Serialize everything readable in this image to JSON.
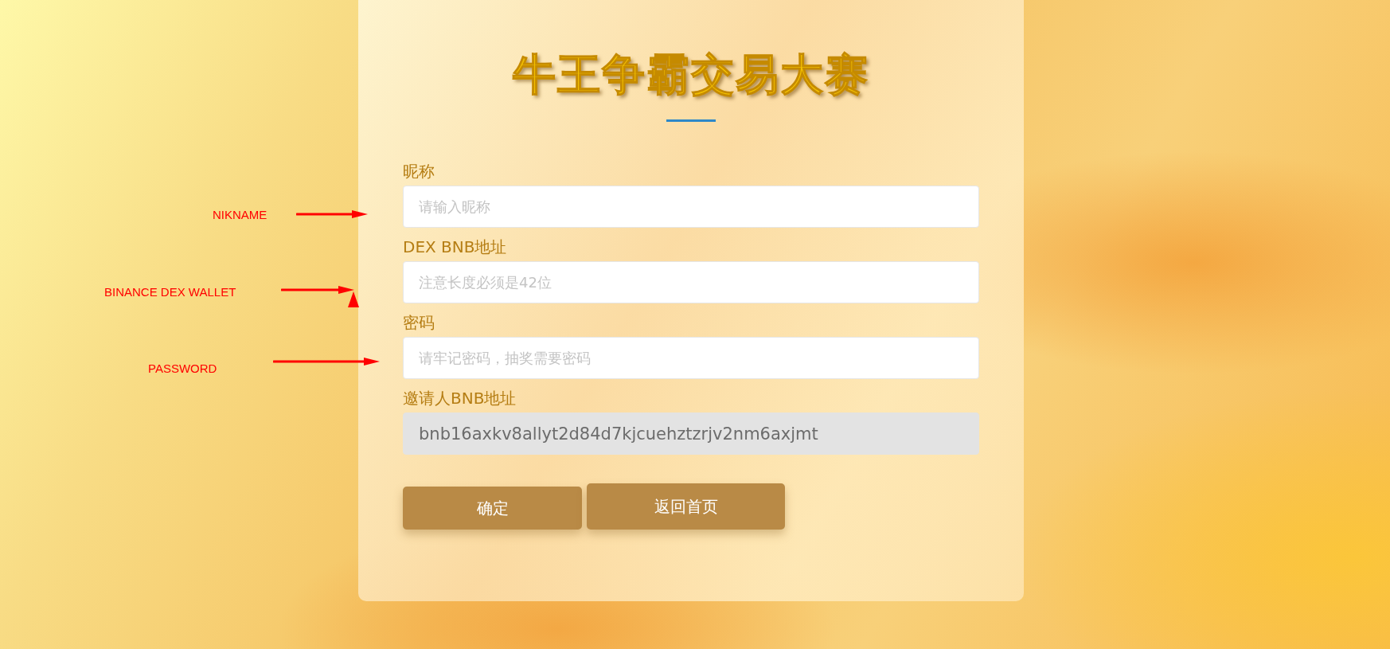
{
  "title": "牛王争霸交易大赛",
  "fields": [
    {
      "label": "昵称",
      "placeholder": "请输入昵称",
      "disabled": false
    },
    {
      "label": "DEX BNB地址",
      "placeholder": "注意长度必须是42位",
      "disabled": false
    },
    {
      "label": "密码",
      "placeholder": "请牢记密码，抽奖需要密码",
      "disabled": false
    },
    {
      "label": "邀请人BNB地址",
      "value": "bnb16axkv8allyt2d84d7kjcuehztzrjv2nm6axjmt",
      "disabled": true
    }
  ],
  "buttons": [
    "确定",
    "返回首页"
  ],
  "annotations": [
    {
      "text": "NIKNAME"
    },
    {
      "text": "BINANCE DEX WALLET"
    },
    {
      "text": "PASSWORD"
    }
  ]
}
